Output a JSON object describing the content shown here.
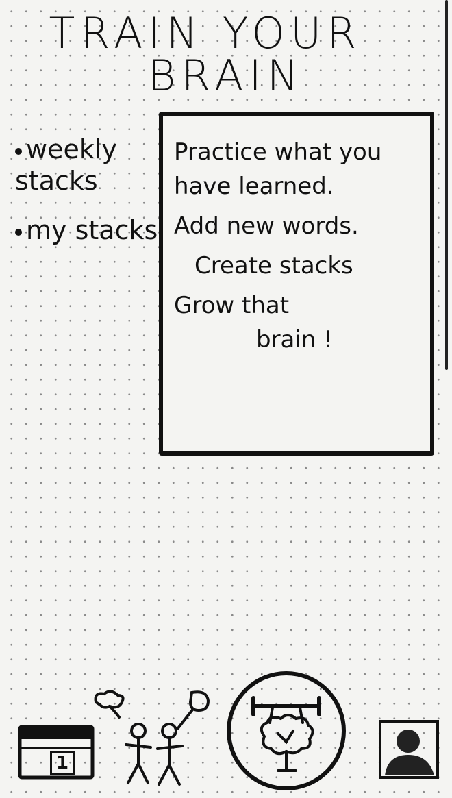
{
  "header": {
    "title_line1": "TRAIN YOUR",
    "title_line2": "BRAIN"
  },
  "nav": {
    "items": [
      {
        "label": "weekly stacks"
      },
      {
        "label": "my stacks"
      }
    ]
  },
  "info": {
    "line1": "Practice what you have learned.",
    "line2": "Add new words.",
    "line3": "Create stacks",
    "line4": "Grow that",
    "line5": "brain !"
  },
  "tabbar": {
    "calendar_day": "1",
    "icons": [
      "calendar-icon",
      "community-icon",
      "train-brain-icon",
      "profile-icon"
    ]
  }
}
